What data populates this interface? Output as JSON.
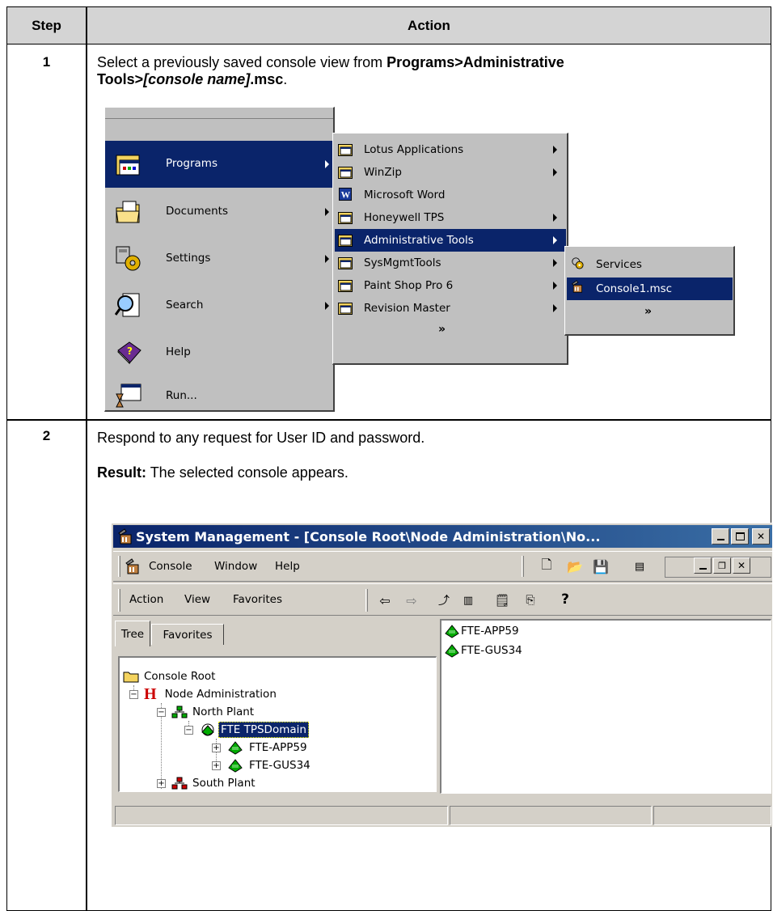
{
  "table": {
    "header_step": "Step",
    "header_action": "Action"
  },
  "step1": {
    "number": "1",
    "text_plain": "Select a previously saved console view from ",
    "text_bold_line1": "Programs>Administrative",
    "text_bold_line2a": "Tools>",
    "text_bold_italic": "[console name]",
    "text_bold_line2b": ".msc",
    "text_end": "."
  },
  "start_menu": {
    "items": [
      {
        "label": "Programs",
        "icon": "programs-icon",
        "has_submenu": true,
        "selected": true
      },
      {
        "label": "Documents",
        "icon": "documents-icon",
        "has_submenu": true,
        "selected": false
      },
      {
        "label": "Settings",
        "icon": "settings-icon",
        "has_submenu": true,
        "selected": false
      },
      {
        "label": "Search",
        "icon": "search-icon",
        "has_submenu": true,
        "selected": false
      },
      {
        "label": "Help",
        "icon": "help-book-icon",
        "has_submenu": false,
        "selected": false
      },
      {
        "label": "Run...",
        "icon": "run-icon",
        "has_submenu": false,
        "selected": false
      }
    ],
    "programs_submenu": [
      {
        "label": "Lotus Applications",
        "has_submenu": true
      },
      {
        "label": "WinZip",
        "has_submenu": true
      },
      {
        "label": "Microsoft Word",
        "has_submenu": false
      },
      {
        "label": "Honeywell TPS",
        "has_submenu": true
      },
      {
        "label": "Administrative Tools",
        "has_submenu": true,
        "selected": true
      },
      {
        "label": "SysMgmtTools",
        "has_submenu": true
      },
      {
        "label": "Paint Shop Pro 6",
        "has_submenu": true
      },
      {
        "label": "Revision Master",
        "has_submenu": true
      }
    ],
    "admin_submenu": [
      {
        "label": "Services",
        "selected": false
      },
      {
        "label": "Console1.msc",
        "selected": true
      }
    ],
    "expand_glyph": "»"
  },
  "step2": {
    "number": "2",
    "instruction": "Respond to any request for User ID and password.",
    "result_label": "Result:",
    "result_text": " The selected console appears."
  },
  "mmc": {
    "title": "System Management - [Console Root\\Node Administration\\No...",
    "menu": {
      "console": "Console",
      "window": "Window",
      "help": "Help"
    },
    "action_bar": {
      "action": "Action",
      "view": "View",
      "favorites": "Favorites"
    },
    "tabs": {
      "tree": "Tree",
      "favorites": "Favorites"
    },
    "tree": {
      "root": "Console Root",
      "node_admin": "Node Administration",
      "north_plant": "North Plant",
      "domain": "FTE TPSDomain",
      "app59": "FTE-APP59",
      "gus34": "FTE-GUS34",
      "south_plant": "South Plant"
    },
    "list_items": [
      "FTE-APP59",
      "FTE-GUS34"
    ],
    "colors": {
      "selection": "#0a246a",
      "titlebar": "#0a246a",
      "face": "#d4d0c8",
      "node_admin_h": "#cc0000"
    }
  }
}
